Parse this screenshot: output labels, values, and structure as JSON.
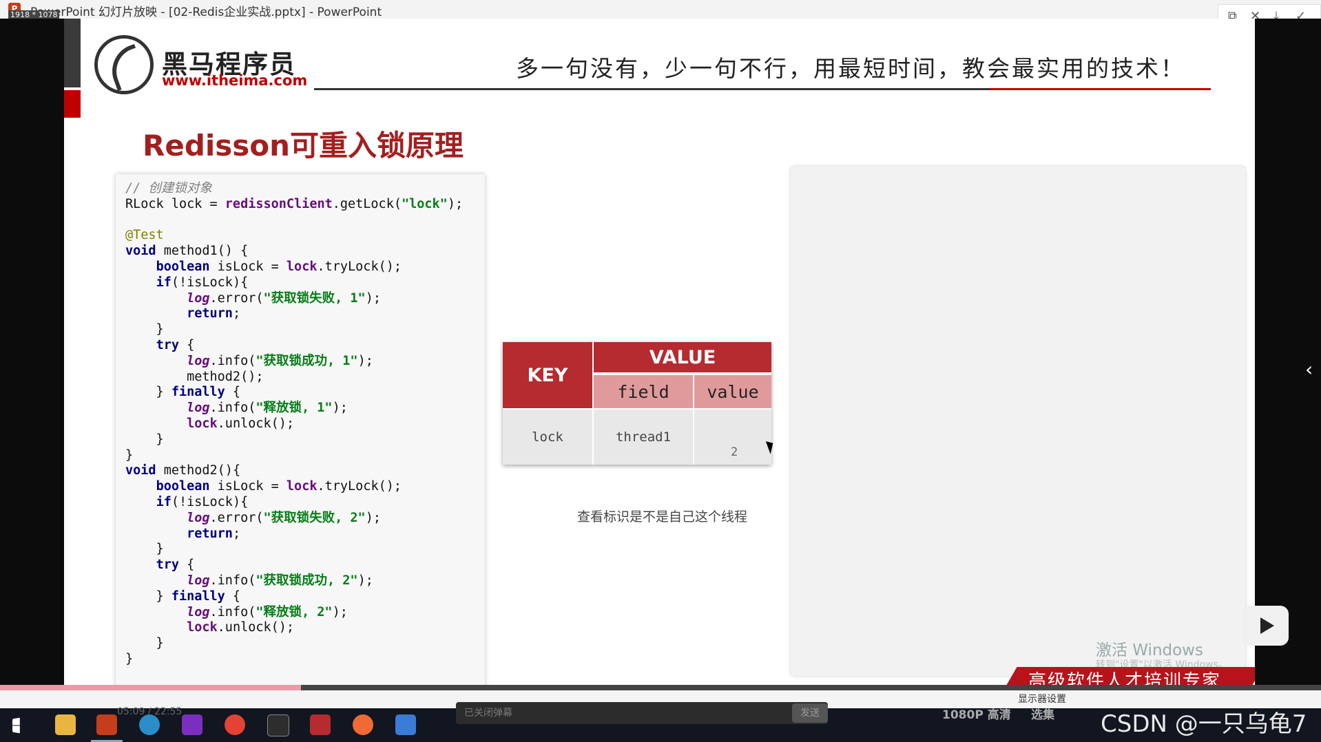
{
  "window": {
    "title": "PowerPoint 幻灯片放映 - [02-Redis企业实战.pptx] - PowerPoint",
    "resolution_badge": "1918 * 1078"
  },
  "slide": {
    "logo_cn": "黑马程序员",
    "logo_url": "www.itheima.com",
    "slogan": "多一句没有，少一句不行，用最短时间，教会最实用的技术！",
    "title": "Redisson可重入锁原理",
    "code_lines": [
      [
        [
          "cm",
          "// 创建锁对象"
        ]
      ],
      [
        [
          "",
          "RLock lock = "
        ],
        [
          "fd",
          "redissonClient"
        ],
        [
          "",
          ".getLock("
        ],
        [
          "st",
          "\"lock\""
        ],
        [
          "",
          ");"
        ]
      ],
      [
        [
          "",
          ""
        ]
      ],
      [
        [
          "an",
          "@Test"
        ]
      ],
      [
        [
          "kw",
          "void"
        ],
        [
          "",
          " method1() {"
        ]
      ],
      [
        [
          "",
          "    "
        ],
        [
          "kw",
          "boolean"
        ],
        [
          "",
          " isLock = "
        ],
        [
          "fd",
          "lock"
        ],
        [
          "",
          ".tryLock();"
        ]
      ],
      [
        [
          "",
          "    "
        ],
        [
          "kw",
          "if"
        ],
        [
          "",
          "(!isLock){"
        ]
      ],
      [
        [
          "",
          "        "
        ],
        [
          "lg",
          "log"
        ],
        [
          "",
          ".error("
        ],
        [
          "st",
          "\"获取锁失败, 1\""
        ],
        [
          "",
          ");"
        ]
      ],
      [
        [
          "",
          "        "
        ],
        [
          "kw",
          "return"
        ],
        [
          "",
          ";"
        ]
      ],
      [
        [
          "",
          "    }"
        ]
      ],
      [
        [
          "",
          "    "
        ],
        [
          "kw",
          "try"
        ],
        [
          "",
          " {"
        ]
      ],
      [
        [
          "",
          "        "
        ],
        [
          "lg",
          "log"
        ],
        [
          "",
          ".info("
        ],
        [
          "st",
          "\"获取锁成功, 1\""
        ],
        [
          "",
          ");"
        ]
      ],
      [
        [
          "",
          "        method2();"
        ]
      ],
      [
        [
          "",
          "    } "
        ],
        [
          "kw",
          "finally"
        ],
        [
          "",
          " {"
        ]
      ],
      [
        [
          "",
          "        "
        ],
        [
          "lg",
          "log"
        ],
        [
          "",
          ".info("
        ],
        [
          "st",
          "\"释放锁, 1\""
        ],
        [
          "",
          ");"
        ]
      ],
      [
        [
          "",
          "        "
        ],
        [
          "fd",
          "lock"
        ],
        [
          "",
          ".unlock();"
        ]
      ],
      [
        [
          "",
          "    }"
        ]
      ],
      [
        [
          "",
          "}"
        ]
      ],
      [
        [
          "kw",
          "void"
        ],
        [
          "",
          " method2(){"
        ]
      ],
      [
        [
          "",
          "    "
        ],
        [
          "kw",
          "boolean"
        ],
        [
          "",
          " isLock = "
        ],
        [
          "fd",
          "lock"
        ],
        [
          "",
          ".tryLock();"
        ]
      ],
      [
        [
          "",
          "    "
        ],
        [
          "kw",
          "if"
        ],
        [
          "",
          "(!isLock){"
        ]
      ],
      [
        [
          "",
          "        "
        ],
        [
          "lg",
          "log"
        ],
        [
          "",
          ".error("
        ],
        [
          "st",
          "\"获取锁失败, 2\""
        ],
        [
          "",
          ");"
        ]
      ],
      [
        [
          "",
          "        "
        ],
        [
          "kw",
          "return"
        ],
        [
          "",
          ";"
        ]
      ],
      [
        [
          "",
          "    }"
        ]
      ],
      [
        [
          "",
          "    "
        ],
        [
          "kw",
          "try"
        ],
        [
          "",
          " {"
        ]
      ],
      [
        [
          "",
          "        "
        ],
        [
          "lg",
          "log"
        ],
        [
          "",
          ".info("
        ],
        [
          "st",
          "\"获取锁成功, 2\""
        ],
        [
          "",
          ");"
        ]
      ],
      [
        [
          "",
          "    } "
        ],
        [
          "kw",
          "finally"
        ],
        [
          "",
          " {"
        ]
      ],
      [
        [
          "",
          "        "
        ],
        [
          "lg",
          "log"
        ],
        [
          "",
          ".info("
        ],
        [
          "st",
          "\"释放锁, 2\""
        ],
        [
          "",
          ");"
        ]
      ],
      [
        [
          "",
          "        "
        ],
        [
          "fd",
          "lock"
        ],
        [
          "",
          ".unlock();"
        ]
      ],
      [
        [
          "",
          "    }"
        ]
      ],
      [
        [
          "",
          "}"
        ]
      ]
    ],
    "table": {
      "key_header": "KEY",
      "value_header": "VALUE",
      "field_header": "field",
      "value_sub_header": "value",
      "key": "lock",
      "field": "thread1",
      "count": "2"
    },
    "note": "查看标识是不是自己这个线程",
    "watermark": "激活 Windows",
    "watermark_sub": "转到\"设置\"以激活 Windows。",
    "banner": "高级软件人才培训专家"
  },
  "player": {
    "time": "05:09 / 22:55",
    "danmu_placeholder": "已关闭弹幕",
    "send": "发送",
    "quality": "1080P 高清",
    "select_episode": "选集",
    "monitor_settings": "显示器设置"
  },
  "overlay": {
    "csdn": "CSDN @一只乌龟7"
  },
  "colors": {
    "brand_red": "#b52b30",
    "title_red": "#a31f1f",
    "field_pink": "#e09a9c"
  }
}
